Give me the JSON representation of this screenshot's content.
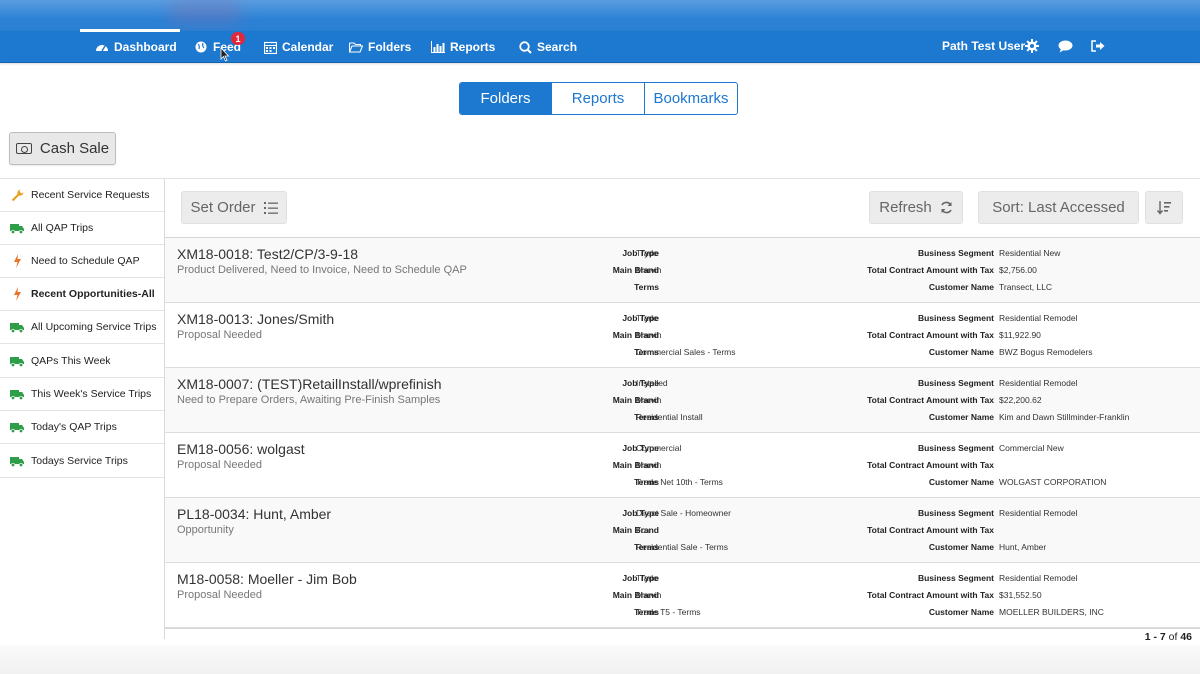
{
  "nav": {
    "items": [
      {
        "label": "Dashboard",
        "icon": "dashboard-icon"
      },
      {
        "label": "Feed",
        "icon": "globe-icon",
        "badge": "1"
      },
      {
        "label": "Calendar",
        "icon": "calendar-icon"
      },
      {
        "label": "Folders",
        "icon": "folder-icon"
      },
      {
        "label": "Reports",
        "icon": "bar-chart-icon"
      },
      {
        "label": "Search",
        "icon": "search-icon"
      }
    ],
    "user_name": "Path Test User",
    "active": "Dashboard"
  },
  "tabs": [
    {
      "label": "Folders",
      "active": true
    },
    {
      "label": "Reports",
      "active": false
    },
    {
      "label": "Bookmarks",
      "active": false
    }
  ],
  "cash_sale_label": "Cash Sale",
  "sidebar": {
    "items": [
      {
        "label": "Recent Service Requests",
        "icon": "wrench-icon",
        "bold": false
      },
      {
        "label": "All QAP Trips",
        "icon": "truck-icon",
        "bold": false
      },
      {
        "label": "Need to Schedule QAP",
        "icon": "lightning-icon",
        "bold": false
      },
      {
        "label": "Recent Opportunities-All",
        "icon": "lightning-icon",
        "bold": true
      },
      {
        "label": "All Upcoming Service Trips",
        "icon": "truck-icon",
        "bold": false
      },
      {
        "label": "QAPs This Week",
        "icon": "truck-icon",
        "bold": false
      },
      {
        "label": "This Week's Service Trips",
        "icon": "truck-icon",
        "bold": false
      },
      {
        "label": "Today's QAP Trips",
        "icon": "truck-icon",
        "bold": false
      },
      {
        "label": "Todays Service Trips",
        "icon": "truck-icon",
        "bold": false
      }
    ]
  },
  "toolbar": {
    "set_order_label": "Set Order",
    "refresh_label": "Refresh",
    "sort_label": "Sort: Last Accessed"
  },
  "field_labels": {
    "job_type": "Job Type",
    "main_brand": "Main Brand",
    "terms": "Terms",
    "business_segment": "Business Segment",
    "total_contract": "Total Contract Amount with Tax",
    "customer_name": "Customer Name"
  },
  "rows": [
    {
      "title": "XM18-0018: Test2/CP/3-9-18",
      "status": "Product Delivered, Need to Invoice, Need to Schedule QAP",
      "job_type": "Trade",
      "main_brand": "Marvin",
      "terms": "",
      "business_segment": "Residential New",
      "total_contract": "$2,756.00",
      "customer_name": "Transect, LLC"
    },
    {
      "title": "XM18-0013: Jones/Smith",
      "status": "Proposal Needed",
      "job_type": "Trade",
      "main_brand": "Marvin",
      "terms": "Commercial Sales - Terms",
      "business_segment": "Residential Remodel",
      "total_contract": "$11,922.90",
      "customer_name": "BWZ Bogus Remodelers"
    },
    {
      "title": "XM18-0007: (TEST)RetailInstall/wprefinish",
      "status": "Need to Prepare Orders, Awaiting Pre-Finish Samples",
      "job_type": "Installed",
      "main_brand": "Marvin",
      "terms": "Residential Install",
      "business_segment": "Residential Remodel",
      "total_contract": "$22,200.62",
      "customer_name": "Kim and Dawn Stillminder-Franklin"
    },
    {
      "title": "EM18-0056: wolgast",
      "status": "Proposal Needed",
      "job_type": "Commercial",
      "main_brand": "Marvin",
      "terms": "Trade Net 10th - Terms",
      "business_segment": "Commercial New",
      "total_contract": "",
      "customer_name": "WOLGAST CORPORATION"
    },
    {
      "title": "PL18-0034: Hunt, Amber",
      "status": "Opportunity",
      "job_type": "Direct Sale - Homeowner",
      "main_brand": "Fox",
      "terms": "Residential Sale - Terms",
      "business_segment": "Residential Remodel",
      "total_contract": "",
      "customer_name": "Hunt, Amber"
    },
    {
      "title": "M18-0058: Moeller - Jim Bob",
      "status": "Proposal Needed",
      "job_type": "Trade",
      "main_brand": "Marvin",
      "terms": "Trade T5 - Terms",
      "business_segment": "Residential Remodel",
      "total_contract": "$31,552.50",
      "customer_name": "MOELLER BUILDERS, INC"
    }
  ],
  "pager": {
    "range": "1 - 7",
    "of_label": "of",
    "total": "46"
  },
  "colors": {
    "primary": "#1d78cf",
    "badge": "#e0283c",
    "truck": "#2e9e48",
    "lightning": "#e8742a",
    "wrench": "#e8a020"
  }
}
